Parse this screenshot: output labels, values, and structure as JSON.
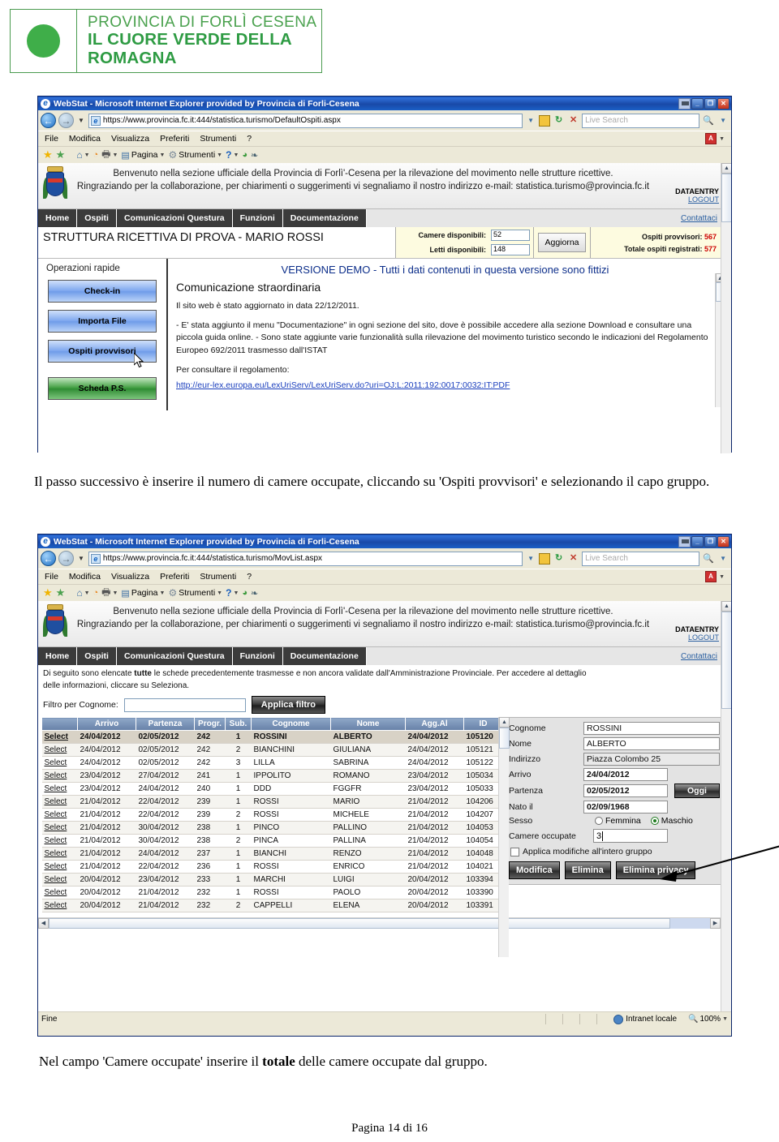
{
  "logo": {
    "line1": "PROVINCIA DI FORLÌ CESENA",
    "line2": "IL CUORE VERDE DELLA ROMAGNA"
  },
  "window1": {
    "title": "WebStat - Microsoft Internet Explorer provided by Provincia di Forli-Cesena",
    "url": "https://www.provincia.fc.it:444/statistica.turismo/DefaultOspiti.aspx",
    "search_placeholder": "Live Search",
    "menu": [
      "File",
      "Modifica",
      "Visualizza",
      "Preferiti",
      "Strumenti",
      "?"
    ],
    "command_bar": {
      "page_label": "Pagina",
      "tools_label": "Strumenti"
    },
    "banner": {
      "text_line1": "Benvenuto nella sezione ufficiale della Provincia di Forlì'-Cesena per la rilevazione del movimento nelle strutture ricettive.",
      "text_line2": "Ringraziando per la collaborazione, per chiarimenti o suggerimenti vi segnaliamo il nostro indirizzo e-mail: statistica.turismo@provincia.fc.it",
      "user": "DATAENTRY",
      "logout": "LOGOUT",
      "contact": "Contattaci"
    },
    "nav": [
      "Home",
      "Ospiti",
      "Comunicazioni Questura",
      "Funzioni",
      "Documentazione"
    ],
    "structure_name": "STRUTTURA RICETTIVA DI PROVA - MARIO ROSSI",
    "counters": {
      "rooms_label": "Camere disponibili:",
      "rooms_value": "52",
      "beds_label": "Letti disponibili:",
      "beds_value": "148",
      "refresh_button": "Aggiorna",
      "provisional_label": "Ospiti provvisori:",
      "provisional_value": "567",
      "total_label": "Totale ospiti registrati:",
      "total_value": "577"
    },
    "sidebar": {
      "title": "Operazioni rapide",
      "buttons": [
        "Check-in",
        "Importa File",
        "Ospiti provvisori",
        "Scheda P.S."
      ]
    },
    "main": {
      "demo_notice": "VERSIONE DEMO - Tutti i dati contenuti in questa versione sono fittizi",
      "heading": "Comunicazione straordinaria",
      "paragraph1": "Il sito web è stato aggiornato in data 22/12/2011.",
      "paragraph2": "- E' stata aggiunto il menu \"Documentazione\" in ogni sezione del sito, dove è possibile accedere alla sezione Download e consultare una piccola guida online. - Sono state aggiunte varie funzionalità sulla rilevazione del movimento turistico secondo le indicazioni del Regolamento Europeo 692/2011 trasmesso dall'ISTAT",
      "paragraph3": "Per consultare il regolamento:",
      "link": "http://eur-lex.europa.eu/LexUriServ/LexUriServ.do?uri=OJ:L:2011:192:0017:0032:IT:PDF"
    }
  },
  "caption1": "Il passo successivo è inserire il numero di camere occupate, cliccando su 'Ospiti provvisori' e selezionando il capo gruppo.",
  "window2": {
    "title": "WebStat - Microsoft Internet Explorer provided by Provincia di Forli-Cesena",
    "url": "https://www.provincia.fc.it:444/statistica.turismo/MovList.aspx",
    "search_placeholder": "Live Search",
    "menu": [
      "File",
      "Modifica",
      "Visualizza",
      "Preferiti",
      "Strumenti",
      "?"
    ],
    "command_bar": {
      "page_label": "Pagina",
      "tools_label": "Strumenti"
    },
    "banner": {
      "text_line1": "Benvenuto nella sezione ufficiale della Provincia di Forlì'-Cesena per la rilevazione del movimento nelle strutture ricettive.",
      "text_line2": "Ringraziando per la collaborazione, per chiarimenti o suggerimenti vi segnaliamo il nostro indirizzo e-mail: statistica.turismo@provincia.fc.it",
      "user": "DATAENTRY",
      "logout": "LOGOUT",
      "contact": "Contattaci"
    },
    "nav": [
      "Home",
      "Ospiti",
      "Comunicazioni Questura",
      "Funzioni",
      "Documentazione"
    ],
    "intro_line1_a": "Di seguito sono elencate ",
    "intro_line1_b": "tutte",
    "intro_line1_c": " le schede precedentemente trasmesse e non ancora validate dall'Amministrazione Provinciale. Per accedere al dettaglio",
    "intro_line2": "delle informazioni, cliccare su Seleziona.",
    "filter": {
      "label": "Filtro per Cognome:",
      "value": "",
      "button": "Applica filtro"
    },
    "table": {
      "select_label": "Select",
      "columns": [
        "",
        "Arrivo",
        "Partenza",
        "Progr.",
        "Sub.",
        "Cognome",
        "Nome",
        "Agg.Al",
        "ID"
      ],
      "rows": [
        {
          "arrivo": "24/04/2012",
          "partenza": "02/05/2012",
          "progr": "242",
          "sub": "1",
          "cognome": "ROSSINI",
          "nome": "ALBERTO",
          "agg": "24/04/2012",
          "id": "105120",
          "selected": true
        },
        {
          "arrivo": "24/04/2012",
          "partenza": "02/05/2012",
          "progr": "242",
          "sub": "2",
          "cognome": "BIANCHINI",
          "nome": "GIULIANA",
          "agg": "24/04/2012",
          "id": "105121",
          "selected": false
        },
        {
          "arrivo": "24/04/2012",
          "partenza": "02/05/2012",
          "progr": "242",
          "sub": "3",
          "cognome": "LILLA",
          "nome": "SABRINA",
          "agg": "24/04/2012",
          "id": "105122",
          "selected": false
        },
        {
          "arrivo": "23/04/2012",
          "partenza": "27/04/2012",
          "progr": "241",
          "sub": "1",
          "cognome": "IPPOLITO",
          "nome": "ROMANO",
          "agg": "23/04/2012",
          "id": "105034",
          "selected": false
        },
        {
          "arrivo": "23/04/2012",
          "partenza": "24/04/2012",
          "progr": "240",
          "sub": "1",
          "cognome": "DDD",
          "nome": "FGGFR",
          "agg": "23/04/2012",
          "id": "105033",
          "selected": false
        },
        {
          "arrivo": "21/04/2012",
          "partenza": "22/04/2012",
          "progr": "239",
          "sub": "1",
          "cognome": "ROSSI",
          "nome": "MARIO",
          "agg": "21/04/2012",
          "id": "104206",
          "selected": false
        },
        {
          "arrivo": "21/04/2012",
          "partenza": "22/04/2012",
          "progr": "239",
          "sub": "2",
          "cognome": "ROSSI",
          "nome": "MICHELE",
          "agg": "21/04/2012",
          "id": "104207",
          "selected": false
        },
        {
          "arrivo": "21/04/2012",
          "partenza": "30/04/2012",
          "progr": "238",
          "sub": "1",
          "cognome": "PINCO",
          "nome": "PALLINO",
          "agg": "21/04/2012",
          "id": "104053",
          "selected": false
        },
        {
          "arrivo": "21/04/2012",
          "partenza": "30/04/2012",
          "progr": "238",
          "sub": "2",
          "cognome": "PINCA",
          "nome": "PALLINA",
          "agg": "21/04/2012",
          "id": "104054",
          "selected": false
        },
        {
          "arrivo": "21/04/2012",
          "partenza": "24/04/2012",
          "progr": "237",
          "sub": "1",
          "cognome": "BIANCHI",
          "nome": "RENZO",
          "agg": "21/04/2012",
          "id": "104048",
          "selected": false
        },
        {
          "arrivo": "21/04/2012",
          "partenza": "22/04/2012",
          "progr": "236",
          "sub": "1",
          "cognome": "ROSSI",
          "nome": "ENRICO",
          "agg": "21/04/2012",
          "id": "104021",
          "selected": false
        },
        {
          "arrivo": "20/04/2012",
          "partenza": "23/04/2012",
          "progr": "233",
          "sub": "1",
          "cognome": "MARCHI",
          "nome": "LUIGI",
          "agg": "20/04/2012",
          "id": "103394",
          "selected": false
        },
        {
          "arrivo": "20/04/2012",
          "partenza": "21/04/2012",
          "progr": "232",
          "sub": "1",
          "cognome": "ROSSI",
          "nome": "PAOLO",
          "agg": "20/04/2012",
          "id": "103390",
          "selected": false
        },
        {
          "arrivo": "20/04/2012",
          "partenza": "21/04/2012",
          "progr": "232",
          "sub": "2",
          "cognome": "CAPPELLI",
          "nome": "ELENA",
          "agg": "20/04/2012",
          "id": "103391",
          "selected": false
        }
      ]
    },
    "detail": {
      "cognome_label": "Cognome",
      "cognome_value": "ROSSINI",
      "nome_label": "Nome",
      "nome_value": "ALBERTO",
      "indirizzo_label": "Indirizzo",
      "indirizzo_value": "Piazza Colombo 25",
      "arrivo_label": "Arrivo",
      "arrivo_value": "24/04/2012",
      "partenza_label": "Partenza",
      "partenza_value": "02/05/2012",
      "oggi_button": "Oggi",
      "nato_label": "Nato il",
      "nato_value": "02/09/1968",
      "sesso_label": "Sesso",
      "sesso_female": "Femmina",
      "sesso_male": "Maschio",
      "sesso_selected": "Maschio",
      "camere_label": "Camere occupate",
      "camere_value": "3",
      "group_checkbox_label": "Applica modifiche all'intero gruppo",
      "group_checkbox_checked": false,
      "buttons": [
        "Modifica",
        "Elimina",
        "Elimina privacy"
      ]
    },
    "status": {
      "state": "Fine",
      "zone": "Intranet locale",
      "zoom": "100%"
    }
  },
  "caption2_a": "Nel campo 'Camere occupate' inserire il ",
  "caption2_b": "totale",
  "caption2_c": " delle camere occupate dal gruppo.",
  "footer": {
    "page_number": "Pagina 14 di 16"
  },
  "colors": {
    "brand_green": "#3fae49",
    "title_blue": "#1b55b8",
    "nav_dark": "#3b3b3b",
    "counter_red": "#cc0000"
  }
}
